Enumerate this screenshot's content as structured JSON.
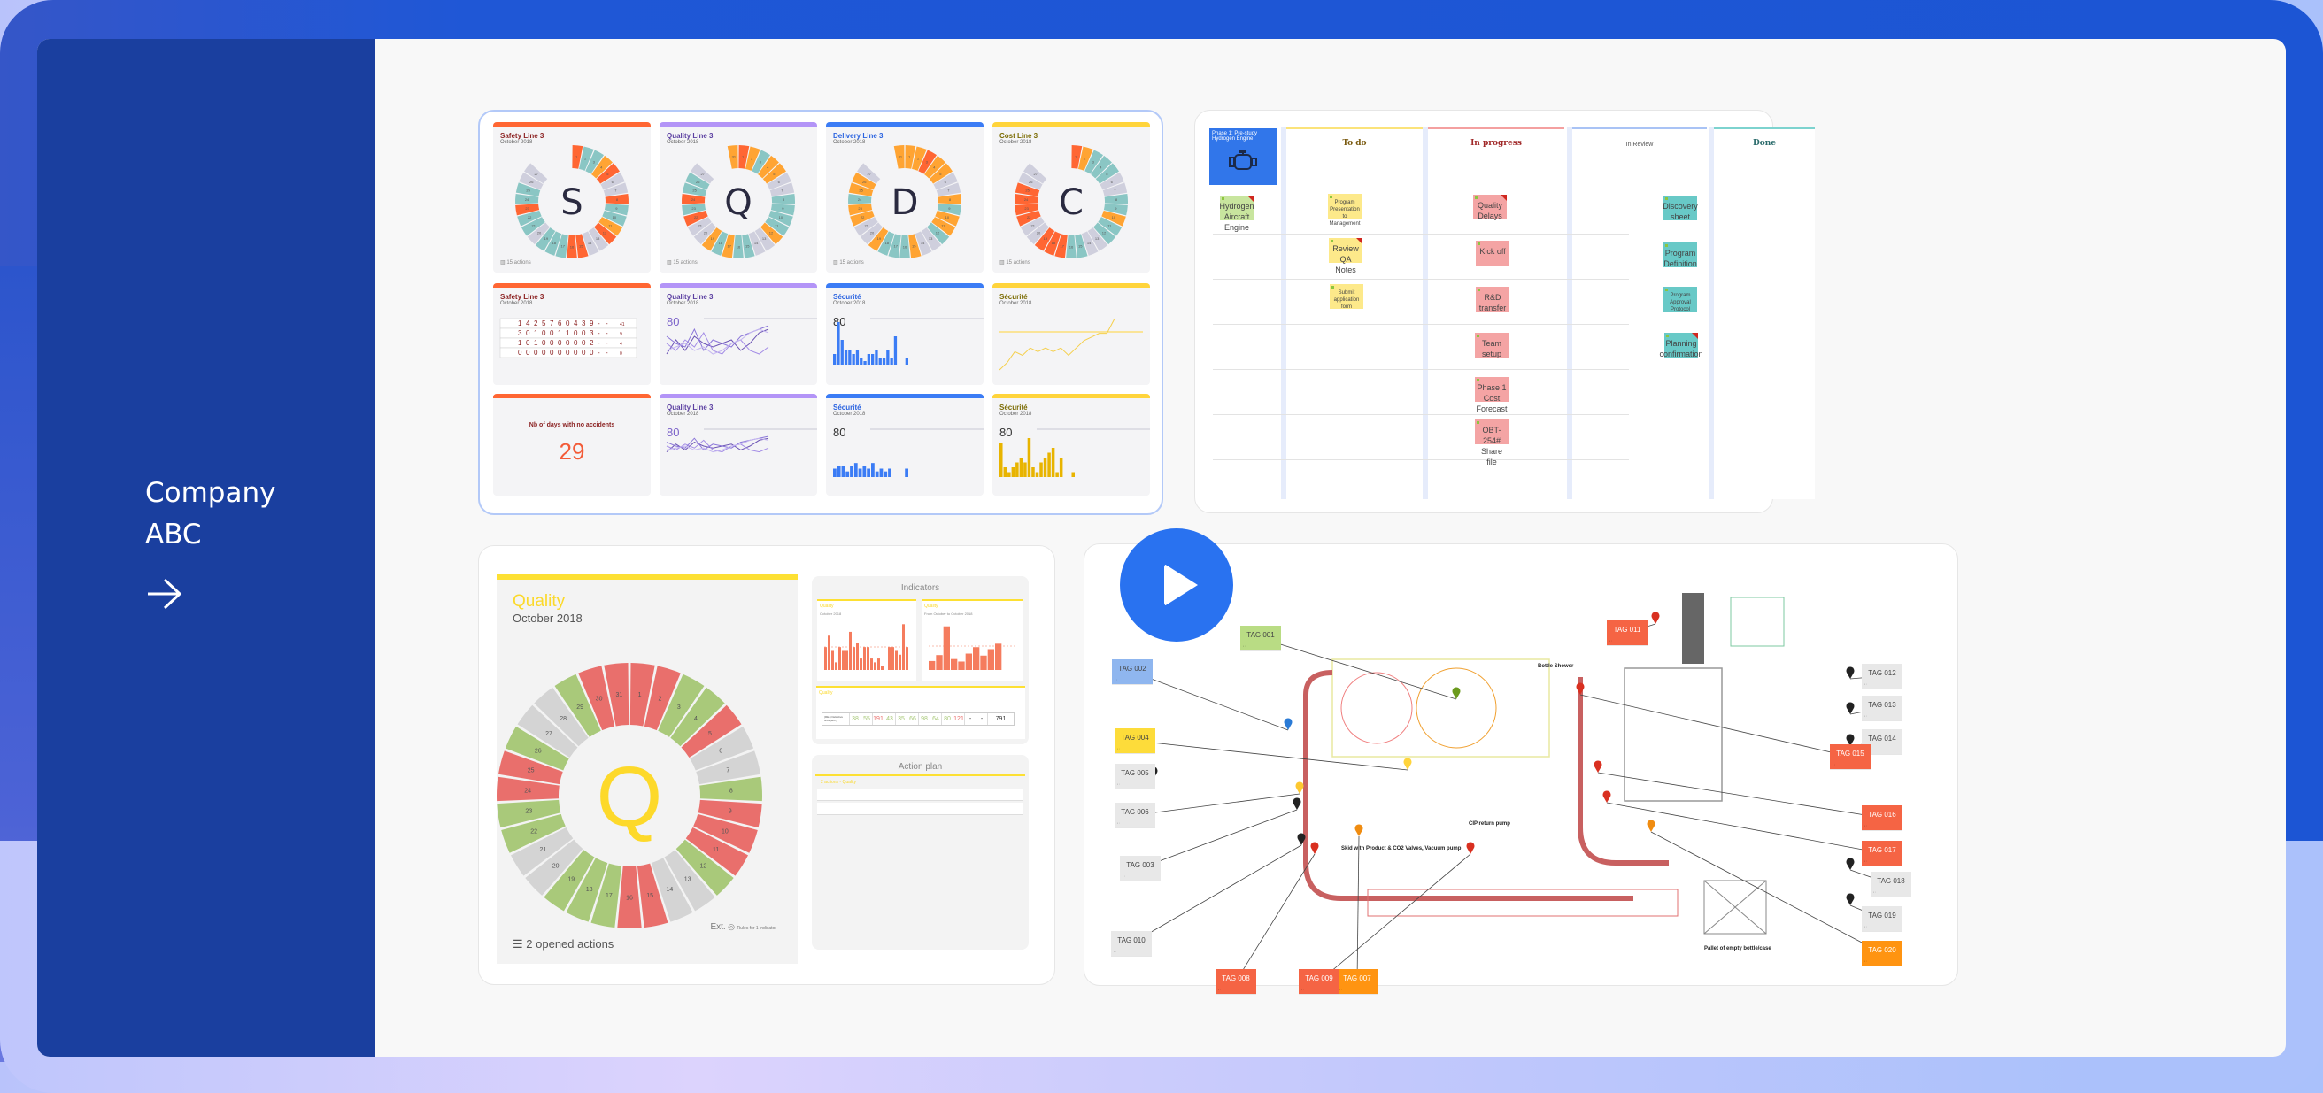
{
  "sidebar": {
    "company_line1": "Company",
    "company_line2": "ABC",
    "arrow_icon": "arrow-right-icon"
  },
  "sqdc_board": {
    "wheels": [
      {
        "title": "Safety Line 3",
        "subtitle": "October 2018",
        "letter": "S",
        "footer": "15 actions",
        "color": "#ff6633",
        "title_color": "#8a1f1f",
        "days": [
          "red",
          "teal",
          "teal",
          "orange",
          "red",
          "gray",
          "gray",
          "red",
          "teal",
          "teal",
          "orange",
          "red",
          "gray",
          "gray",
          "red",
          "red",
          "teal",
          "teal",
          "teal",
          "gray",
          "teal",
          "teal",
          "red",
          "teal",
          "teal",
          "gray",
          "gray",
          "empty",
          "empty",
          "empty",
          "empty"
        ]
      },
      {
        "title": "Quality Line 3",
        "subtitle": "October 2018",
        "letter": "Q",
        "footer": "15 actions",
        "color": "#b394f7",
        "title_color": "#5b3fa1",
        "days": [
          "red",
          "orange",
          "teal",
          "orange",
          "orange",
          "gray",
          "gray",
          "teal",
          "teal",
          "teal",
          "teal",
          "orange",
          "gray",
          "gray",
          "teal",
          "teal",
          "orange",
          "teal",
          "orange",
          "gray",
          "gray",
          "red",
          "teal",
          "red",
          "teal",
          "teal",
          "gray",
          "empty",
          "empty",
          "empty",
          "orange"
        ]
      },
      {
        "title": "Delivery Line 3",
        "subtitle": "October 2018",
        "letter": "D",
        "footer": "15 actions",
        "color": "#3b7cf5",
        "title_color": "#2a63e0",
        "days": [
          "orange",
          "orange",
          "red",
          "orange",
          "orange",
          "gray",
          "gray",
          "orange",
          "teal",
          "orange",
          "orange",
          "teal",
          "gray",
          "gray",
          "orange",
          "teal",
          "teal",
          "teal",
          "orange",
          "gray",
          "gray",
          "orange",
          "orange",
          "teal",
          "orange",
          "orange",
          "gray",
          "empty",
          "empty",
          "empty",
          "orange"
        ]
      },
      {
        "title": "Cost Line 3",
        "subtitle": "October 2018",
        "letter": "C",
        "footer": "15 actions",
        "color": "#ffd43b",
        "title_color": "#7a6a00",
        "days": [
          "red",
          "orange",
          "teal",
          "teal",
          "teal",
          "gray",
          "gray",
          "teal",
          "teal",
          "orange",
          "teal",
          "teal",
          "gray",
          "gray",
          "teal",
          "teal",
          "red",
          "red",
          "red",
          "gray",
          "gray",
          "red",
          "red",
          "red",
          "red",
          "gray",
          "gray",
          "empty",
          "empty",
          "empty",
          "empty"
        ]
      }
    ],
    "row2": [
      {
        "title": "Safety Line 3",
        "subtitle": "October 2018",
        "type": "table",
        "rows": [
          {
            "values": [
              "1",
              "4",
              "2",
              "5",
              "7",
              "6",
              "0",
              "4",
              "3",
              "9",
              "-",
              "-"
            ],
            "total": "41"
          },
          {
            "values": [
              "3",
              "0",
              "1",
              "0",
              "0",
              "1",
              "1",
              "0",
              "0",
              "3",
              "-",
              "-"
            ],
            "total": "9"
          },
          {
            "values": [
              "1",
              "0",
              "1",
              "0",
              "0",
              "0",
              "0",
              "0",
              "0",
              "2",
              "-",
              "-"
            ],
            "total": "4"
          },
          {
            "values": [
              "0",
              "0",
              "0",
              "0",
              "0",
              "0",
              "0",
              "0",
              "0",
              "0",
              "-",
              "-"
            ],
            "total": "0"
          }
        ]
      },
      {
        "title": "Quality Line 3",
        "subtitle": "October 2018",
        "type": "multiline",
        "target": "80"
      },
      {
        "title": "Sécurité",
        "subtitle": "October 2018",
        "type": "bar",
        "target": "80"
      },
      {
        "title": "Sécurité",
        "subtitle": "October 2018",
        "type": "line"
      }
    ],
    "row3": [
      {
        "label": "Nb of days with no accidents",
        "value": "29"
      },
      {
        "title": "Quality Line 3",
        "subtitle": "October 2018",
        "type": "multiline",
        "target": "80"
      },
      {
        "title": "Sécurité",
        "subtitle": "October 2018",
        "type": "bar",
        "target": "80"
      },
      {
        "title": "Sécurité",
        "subtitle": "October 2018",
        "type": "bar",
        "target": "80"
      }
    ]
  },
  "kanban": {
    "phase_card": {
      "line1": "Phase 1: Pre-study",
      "line2": "Hydrogen Engine",
      "icon": "engine-icon"
    },
    "columns": [
      {
        "label": "To do",
        "color": "#fbe37a",
        "text_color": "#7a5a10"
      },
      {
        "label": "In progress",
        "color": "#f4a0a0",
        "text_color": "#a02828"
      },
      {
        "label": "In Review",
        "color": "#a9c3f5",
        "text_color": "#555555"
      },
      {
        "label": "Done",
        "color": "#7dd3cf",
        "text_color": "#2a6b6b"
      }
    ],
    "cards": {
      "backlog": [
        "Hydrogen Aircraft Engine"
      ],
      "todo": [
        "Program Presentation to Management",
        "Review QA Notes",
        "Submit application form"
      ],
      "in_progress": [
        "Quality Delays",
        "Kick off",
        "R&D transfer",
        "Team setup",
        "Phase 1 Cost Forecast",
        "OBT-254# Share file"
      ],
      "done": [
        "Discovery sheet",
        "Program Definition",
        "Program Approval Protocol",
        "Planning confirmation"
      ]
    }
  },
  "quality_wheel": {
    "title": "Quality",
    "date": "October 2018",
    "letter": "Q",
    "days": [
      "red",
      "red",
      "green",
      "green",
      "red",
      "gray",
      "gray",
      "green",
      "red",
      "red",
      "red",
      "green",
      "gray",
      "gray",
      "red",
      "red",
      "green",
      "green",
      "green",
      "gray",
      "gray",
      "green",
      "green",
      "red",
      "red",
      "green",
      "gray",
      "gray",
      "green",
      "red",
      "red"
    ],
    "footer": "2 opened actions",
    "ext_label": "Ext.",
    "ext_note": "Rules for 1 indicator",
    "indicators_title": "Indicators",
    "indicator_charts": [
      {
        "title": "Quality",
        "subtitle": "October 2018"
      },
      {
        "title": "Quality",
        "subtitle": "From October to October 2018"
      }
    ],
    "table": {
      "title": "Quality",
      "row_label": "(REJ) Defective units (Ext.)",
      "values": [
        "38",
        "55",
        "191",
        "43",
        "35",
        "66",
        "98",
        "64",
        "80",
        "121",
        "-",
        "-"
      ],
      "total": "791"
    },
    "action_plan_title": "Action plan",
    "action_plan_group": "2 actions - Quality"
  },
  "plant_layout": {
    "play_icon": "play-icon",
    "tags": [
      {
        "id": "TAG 001",
        "color": "#b9dc84"
      },
      {
        "id": "TAG 002",
        "color": "#8fb6ef"
      },
      {
        "id": "TAG 003",
        "color": "#e8e8e8"
      },
      {
        "id": "TAG 004",
        "color": "#fddc3a"
      },
      {
        "id": "TAG 005",
        "color": "#e8e8e8"
      },
      {
        "id": "TAG 006",
        "color": "#e8e8e8"
      },
      {
        "id": "TAG 007",
        "color": "#ff9411"
      },
      {
        "id": "TAG 008",
        "color": "#f56444"
      },
      {
        "id": "TAG 009",
        "color": "#f56444"
      },
      {
        "id": "TAG 010",
        "color": "#e8e8e8"
      },
      {
        "id": "TAG 011",
        "color": "#f56444"
      },
      {
        "id": "TAG 012",
        "color": "#e8e8e8"
      },
      {
        "id": "TAG 013",
        "color": "#e8e8e8"
      },
      {
        "id": "TAG 014",
        "color": "#e8e8e8"
      },
      {
        "id": "TAG 015",
        "color": "#f56444"
      },
      {
        "id": "TAG 016",
        "color": "#f56444"
      },
      {
        "id": "TAG 017",
        "color": "#f56444"
      },
      {
        "id": "TAG 018",
        "color": "#e8e8e8"
      },
      {
        "id": "TAG 019",
        "color": "#e8e8e8"
      },
      {
        "id": "TAG 020",
        "color": "#ff9411"
      }
    ],
    "labels": {
      "bottle_shower": "Bottle Shower",
      "cip_pump": "CIP return pump",
      "skid": "Skid with Product & CO2 Valves, Vacuum pump",
      "pallet": "Pallet of empty bottle/case"
    }
  },
  "colors": {
    "red": "#ff6633",
    "orange": "#ffa433",
    "teal": "#8ac6c4",
    "gray": "#cfcfdd",
    "green": "#a9c97a",
    "qred": "#e96f6c",
    "qgray": "#d4d4d4"
  }
}
